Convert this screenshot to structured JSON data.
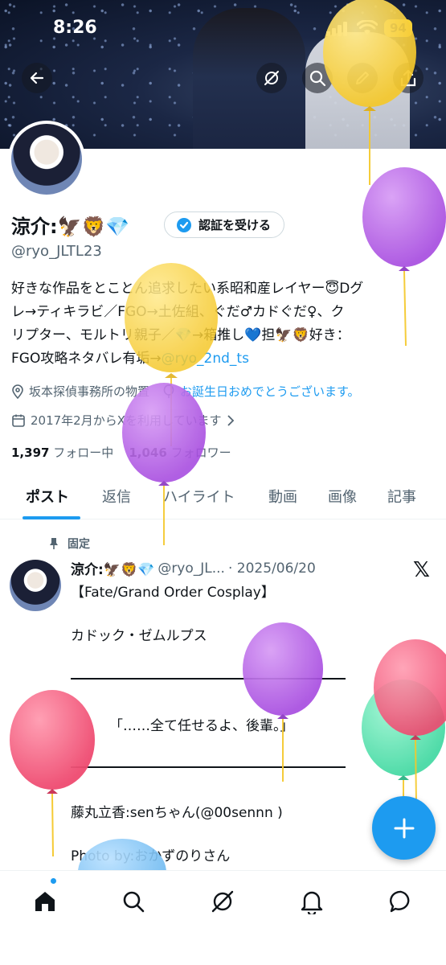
{
  "status_bar": {
    "time": "8:26",
    "battery": "94"
  },
  "header_icons": [
    "back-arrow-icon",
    "grok-icon",
    "search-icon",
    "edit-icon",
    "share-icon"
  ],
  "profile": {
    "name": "涼介:🦅🦁💎",
    "verify_button": "認証を受ける",
    "handle": "@ryo_JLTL23",
    "bio_lines": [
      "好きな作品をとことん追求したい系昭和産レイヤー😇Dグ",
      "レ→ティキラビ／FGO→土佐組、ぐだ♂カドぐだ♀、ク",
      "リプター、モルトリ親子／💎→箱推し💙担🦅🦁好き：",
      "FGO攻略ネタバレ有垢→"
    ],
    "bio_link": "@ryo_2nd_ts",
    "location": "坂本探偵事務所の物置",
    "birthday": "お誕生日おめでとうございます。",
    "joined": "2017年2月からXを利用しています",
    "following_count": "1,397",
    "following_label": "フォロー中",
    "followers_count": "1,046",
    "followers_label": "フォロワー"
  },
  "tabs": [
    "ポスト",
    "返信",
    "ハイライト",
    "動画",
    "画像",
    "記事"
  ],
  "post": {
    "pinned_label": "固定",
    "author_name": "涼介:🦅🦁💎",
    "author_handle": "@ryo_JL...",
    "date": "· 2025/06/20",
    "line1": "【Fate/Grand Order Cosplay】",
    "line2": "カドック・ゼムルプス",
    "line3": "「……全て任せるよ、後輩。」",
    "line4": "藤丸立香:senちゃん(@00sennn )",
    "line5": "Photo by:おかずのりさん"
  },
  "fab_icon": "plus-icon",
  "bottom_nav": [
    "home-icon",
    "search-icon",
    "grok-icon",
    "bell-icon",
    "messages-icon"
  ],
  "balloon_colors": {
    "yellow": "#f5c82a",
    "purple": "#a84ee0",
    "pink": "#ef4a70",
    "green": "#3ed8a0",
    "blue": "#6bb8f0"
  }
}
